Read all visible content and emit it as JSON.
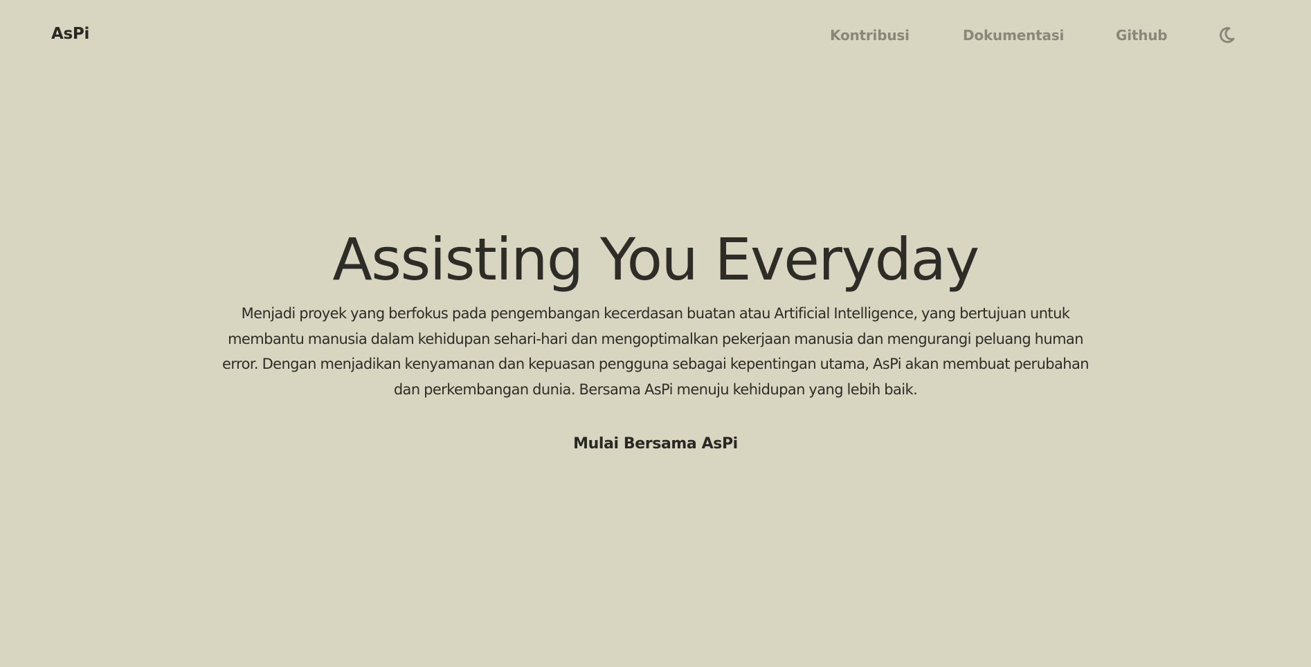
{
  "navbar": {
    "brand": "AsPi",
    "links": [
      {
        "label": "Kontribusi"
      },
      {
        "label": "Dokumentasi"
      },
      {
        "label": "Github"
      }
    ],
    "theme_toggle_icon": "moon-icon"
  },
  "hero": {
    "title": "Assisting You Everyday",
    "description": "Menjadi proyek yang berfokus pada pengembangan kecerdasan buatan atau Artificial Intelligence, yang bertujuan untuk membantu manusia dalam kehidupan sehari-hari dan mengoptimalkan pekerjaan manusia dan mengurangi peluang human error. Dengan menjadikan kenyamanan dan kepuasan pengguna sebagai kepentingan utama, AsPi akan membuat perubahan dan perkembangan dunia. Bersama AsPi menuju kehidupan yang lebih baik.",
    "cta_label": "Mulai Bersama AsPi"
  },
  "colors": {
    "background": "#d8d5c0",
    "text_dark": "#2e2c27",
    "nav_link": "#8a877a"
  }
}
